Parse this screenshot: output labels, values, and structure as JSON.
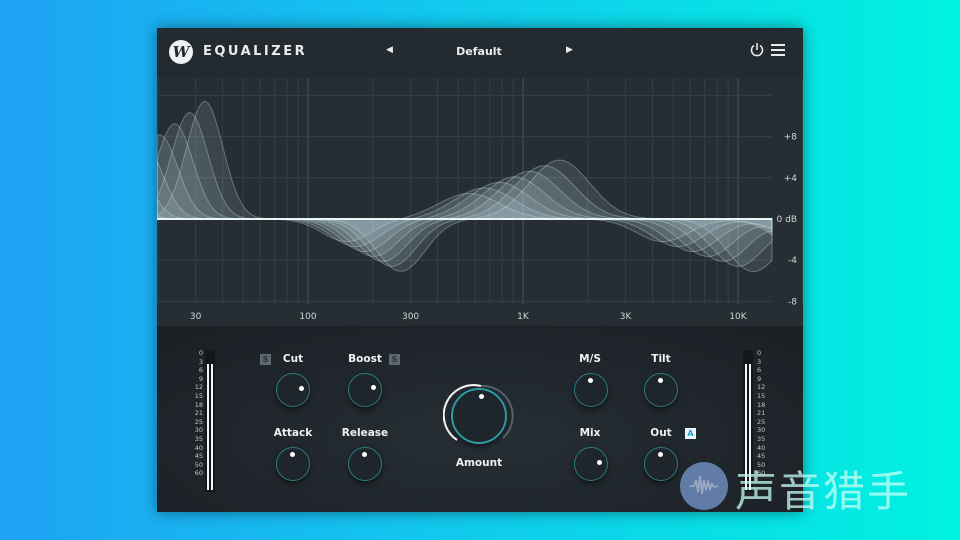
{
  "header": {
    "logo": "W",
    "title": "EQUALIZER",
    "preset": "Default",
    "prev_icon": "triangle-left",
    "next_icon": "triangle-right",
    "power_icon": "power",
    "menu_icon": "hamburger"
  },
  "graph": {
    "freq_labels": [
      "30",
      "100",
      "300",
      "1K",
      "3K",
      "10K"
    ],
    "freqs": [
      30,
      100,
      300,
      1000,
      3000,
      10000
    ],
    "db_labels": [
      "+8",
      "+4",
      "0 dB",
      "-4",
      "-8"
    ],
    "dbs": [
      8,
      4,
      0,
      -4,
      -8
    ],
    "curve_color": "#cfe6ec"
  },
  "controls": {
    "cut": {
      "label": "Cut",
      "badge": "S",
      "value": 0.8
    },
    "boost": {
      "label": "Boost",
      "badge": "S",
      "value": 0.78
    },
    "attack": {
      "label": "Attack",
      "value": 0.5
    },
    "release": {
      "label": "Release",
      "value": 0.5
    },
    "amount": {
      "label": "Amount",
      "value": 0.52
    },
    "ms": {
      "label": "M/S",
      "value": 0.5
    },
    "tilt": {
      "label": "Tilt",
      "value": 0.5
    },
    "mix": {
      "label": "Mix",
      "value": 0.8
    },
    "out": {
      "label": "Out",
      "badge": "A",
      "value": 0.5
    }
  },
  "meter_scale": [
    "0",
    "3",
    "6",
    "9",
    "12",
    "15",
    "18",
    "21",
    "25",
    "30",
    "35",
    "40",
    "45",
    "50",
    "60"
  ],
  "watermark": {
    "text": "声音猎手"
  },
  "colors": {
    "accent": "#2c9aa3",
    "panel": "#22292f"
  }
}
